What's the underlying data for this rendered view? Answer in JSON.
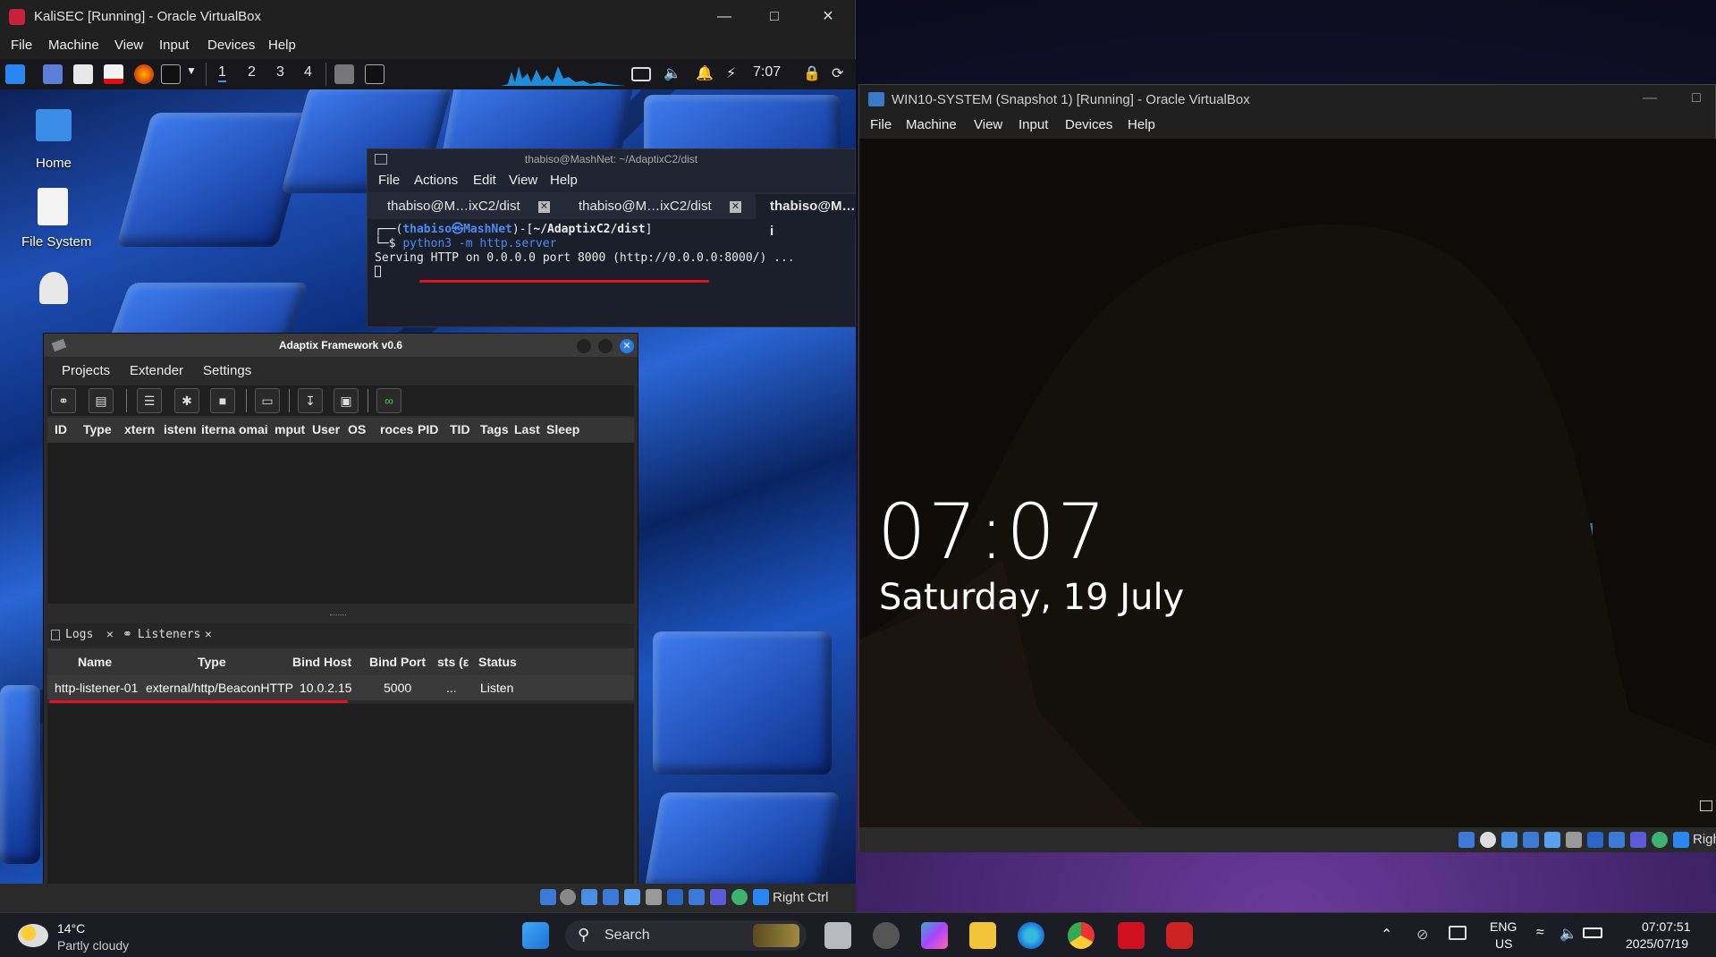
{
  "kali_window": {
    "title": "KaliSEC [Running] - Oracle VirtualBox",
    "menu": [
      "File",
      "Machine",
      "View",
      "Input",
      "Devices",
      "Help"
    ],
    "panel": {
      "workspaces": [
        "1",
        "2",
        "3",
        "4"
      ],
      "clock": "7:07"
    },
    "desktop_icons": {
      "home": "Home",
      "filesystem": "File System"
    },
    "status": {
      "host_key": "Right Ctrl"
    }
  },
  "terminal": {
    "title": "thabiso@MashNet: ~/AdaptixC2/dist",
    "menu": [
      "File",
      "Actions",
      "Edit",
      "View",
      "Help"
    ],
    "tabs": [
      "thabiso@M…ixC2/dist",
      "thabiso@M…ixC2/dist",
      "thabiso@M…i"
    ],
    "line1_prefix": "┌──(",
    "line1_user": "thabiso㉿MashNet",
    "line1_mid": ")-[",
    "line1_path": "~/AdaptixC2/dist",
    "line1_end": "]",
    "line2_prompt": "└─$ ",
    "line2_cmd": "python3 -m http.server",
    "line3": "Serving HTTP on 0.0.0.0 port 8000 (http://0.0.0.0:8000/) ..."
  },
  "adaptix": {
    "title": "Adaptix Framework v0.6",
    "menu": [
      "Projects",
      "Extender",
      "Settings"
    ],
    "session_columns": [
      "ID",
      "Type",
      "xtern",
      "istenı",
      "iterna",
      "omai",
      "mput",
      "User",
      "OS",
      "roces",
      "PID",
      "TID",
      "Tags",
      "Last",
      "Sleep"
    ],
    "bottom_tabs": {
      "logs": "Logs",
      "listeners": "Listeners"
    },
    "listener_columns": [
      "Name",
      "Type",
      "Bind Host",
      "Bind Port",
      "sts (ε",
      "Status"
    ],
    "listener_row": [
      "http-listener-01",
      "external/http/BeaconHTTP",
      "10.0.2.15",
      "5000",
      "...",
      "Listen"
    ]
  },
  "win_window": {
    "title": "WIN10-SYSTEM (Snapshot 1) [Running] - Oracle VirtualBox",
    "menu": [
      "File",
      "Machine",
      "View",
      "Input",
      "Devices",
      "Help"
    ],
    "lock_time": "07:07",
    "lock_date": "Saturday, 19 July",
    "status_host_key": "Righ"
  },
  "taskbar": {
    "weather_temp": "14°C",
    "weather_desc": "Partly cloudy",
    "search": "Search",
    "lang": "ENG",
    "region": "US",
    "time": "07:07:51",
    "date": "2025/07/19"
  },
  "colors": {
    "accent_red": "#e8101e",
    "kali_blue": "#2a66d6",
    "adaptix_bg": "#2b2b2b"
  }
}
